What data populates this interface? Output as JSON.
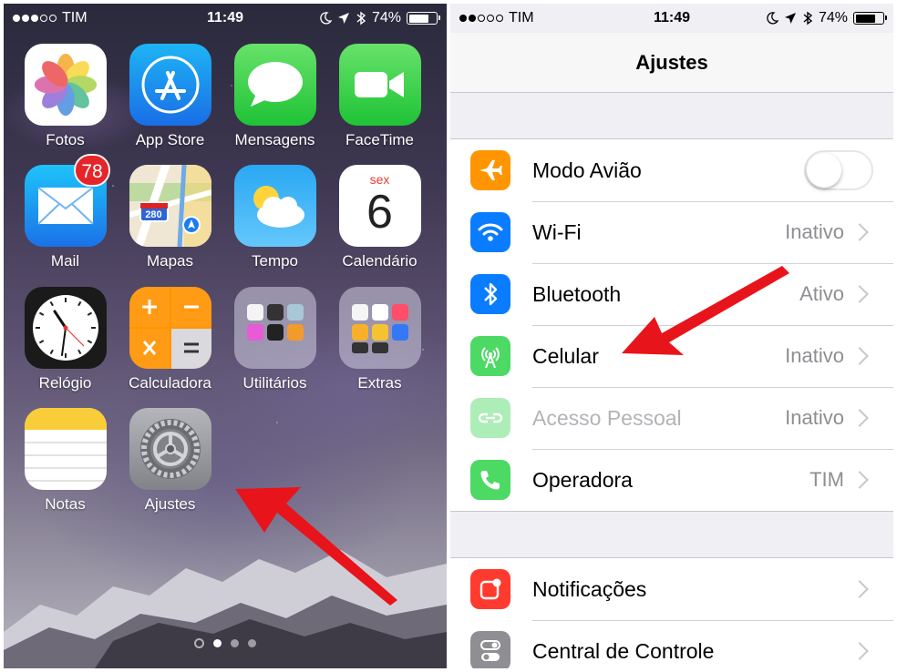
{
  "colors": {
    "arrow": "#e8141b",
    "settings_bg": "#efeff4",
    "orange": "#ff9500",
    "blue": "#0a7cff",
    "green": "#4cd964",
    "red": "#ff3b30",
    "gray": "#8e8e93"
  },
  "home": {
    "status": {
      "carrier": "TIM",
      "time": "11:49",
      "battery": "74%",
      "battery_level": 0.74
    },
    "apps": [
      {
        "label": "Fotos",
        "icon": "photos-icon"
      },
      {
        "label": "App Store",
        "icon": "app-store-icon"
      },
      {
        "label": "Mensagens",
        "icon": "messages-icon"
      },
      {
        "label": "FaceTime",
        "icon": "facetime-icon"
      },
      {
        "label": "Mail",
        "icon": "mail-icon",
        "badge": "78"
      },
      {
        "label": "Mapas",
        "icon": "maps-icon",
        "map_route": "280"
      },
      {
        "label": "Tempo",
        "icon": "weather-icon"
      },
      {
        "label": "Calendário",
        "icon": "calendar-icon",
        "day_name": "sex",
        "day_number": "6"
      },
      {
        "label": "Relógio",
        "icon": "clock-icon"
      },
      {
        "label": "Calculadora",
        "icon": "calculator-icon"
      },
      {
        "label": "Utilitários",
        "icon": "folder-icon"
      },
      {
        "label": "Extras",
        "icon": "folder-icon"
      },
      {
        "label": "Notas",
        "icon": "notes-icon"
      },
      {
        "label": "Ajustes",
        "icon": "settings-gear-icon"
      }
    ],
    "page_indicator": {
      "pages": 3,
      "current": 1
    }
  },
  "settings": {
    "status": {
      "carrier": "TIM",
      "time": "11:49",
      "battery": "74%",
      "battery_level": 0.74
    },
    "title": "Ajustes",
    "group1": [
      {
        "label": "Modo Avião",
        "icon": "airplane-icon",
        "color": "#ff9500",
        "toggle": false
      },
      {
        "label": "Wi-Fi",
        "icon": "wifi-icon",
        "color": "#0a7cff",
        "value": "Inativo"
      },
      {
        "label": "Bluetooth",
        "icon": "bluetooth-icon",
        "color": "#0a7cff",
        "value": "Ativo"
      },
      {
        "label": "Celular",
        "icon": "cellular-antenna-icon",
        "color": "#4cd964",
        "value": "Inativo"
      },
      {
        "label": "Acesso Pessoal",
        "icon": "hotspot-icon",
        "color": "#4cd964",
        "value": "Inativo",
        "disabled": true
      },
      {
        "label": "Operadora",
        "icon": "phone-icon",
        "color": "#4cd964",
        "value": "TIM"
      }
    ],
    "group2": [
      {
        "label": "Notificações",
        "icon": "notifications-icon",
        "color": "#ff3b30"
      },
      {
        "label": "Central de Controle",
        "icon": "control-center-icon",
        "color": "#8e8e93"
      }
    ]
  }
}
